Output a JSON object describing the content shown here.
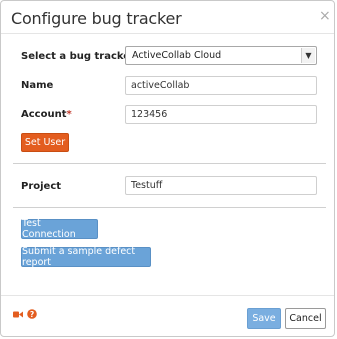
{
  "dialog": {
    "title": "Configure bug tracker",
    "close_glyph": "×"
  },
  "form": {
    "tracker_label": "Select a bug tracker",
    "tracker_value": "ActiveCollab Cloud",
    "name_label": "Name",
    "name_value": "activeCollab",
    "account_label": "Account",
    "account_required": "*",
    "account_value": "123456",
    "set_user_label": "Set User",
    "project_label": "Project",
    "project_value": "Testuff"
  },
  "actions": {
    "test_connection_label": "Test Connection",
    "sample_report_label": "Submit a sample defect report"
  },
  "footer": {
    "icons": [
      "video-icon",
      "help-icon"
    ],
    "save_label": "Save",
    "cancel_label": "Cancel"
  },
  "colors": {
    "orange": "#e35d1f",
    "blue": "#6aa3d8",
    "required": "#c0392b"
  }
}
